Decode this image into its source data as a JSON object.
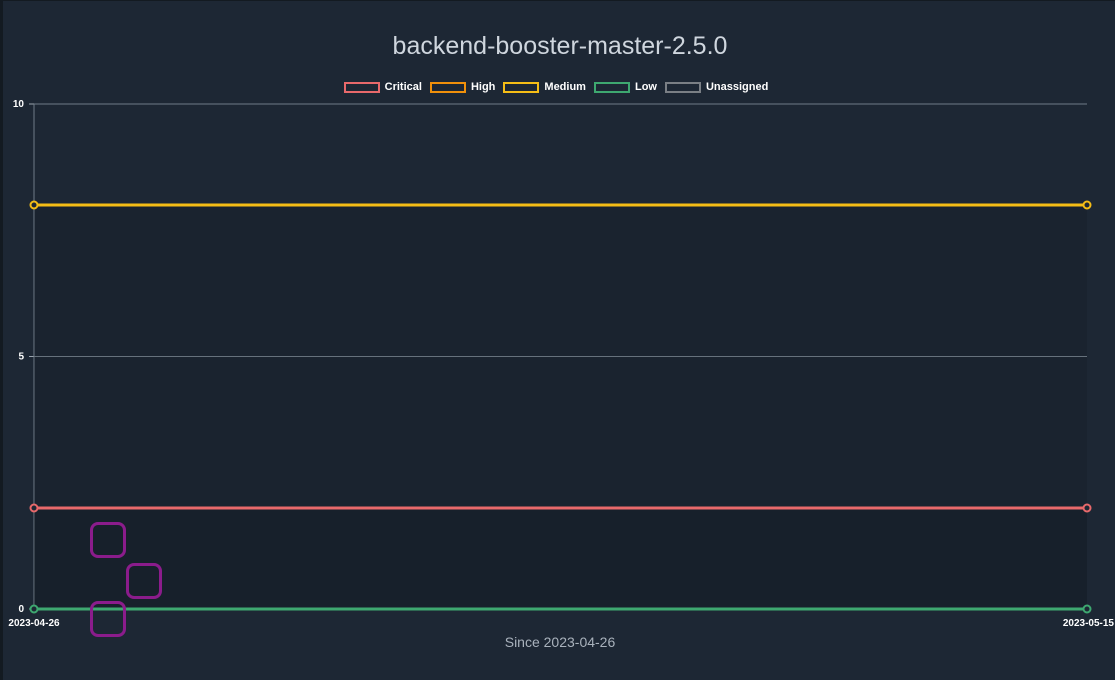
{
  "chart_data": {
    "type": "line",
    "title": "backend-booster-master-2.5.0",
    "x": [
      "2023-04-26",
      "2023-05-15"
    ],
    "x_tick_labels": [
      "2023-04-26",
      "2023-05-15"
    ],
    "y_ticks": [
      0,
      5,
      10
    ],
    "ylim": [
      0,
      10
    ],
    "legend_position": "top",
    "grid": true,
    "footnote": "Since 2023-04-26",
    "series": [
      {
        "name": "Critical",
        "color": "#e8696b",
        "values": [
          2,
          2
        ]
      },
      {
        "name": "High",
        "color": "#f0900b",
        "values": [
          null,
          null
        ]
      },
      {
        "name": "Medium",
        "color": "#f5bd16",
        "values": [
          8,
          8
        ]
      },
      {
        "name": "Low",
        "color": "#3ea870",
        "values": [
          0,
          0
        ]
      },
      {
        "name": "Unassigned",
        "color": "#7a7f85",
        "values": [
          null,
          null
        ]
      }
    ]
  }
}
